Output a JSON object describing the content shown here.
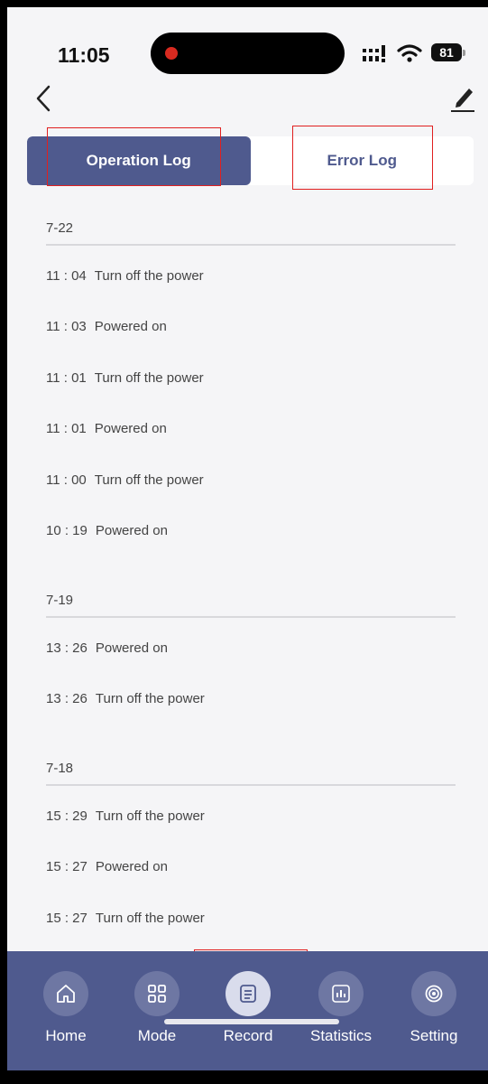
{
  "status_bar": {
    "time": "11:05",
    "battery": "81"
  },
  "tabs": {
    "operation": "Operation Log",
    "error": "Error Log",
    "active": "operation"
  },
  "groups": [
    {
      "date": "7-22",
      "entries": [
        {
          "time": "11 : 04",
          "text": "Turn off the power"
        },
        {
          "time": "11 : 03",
          "text": "Powered on"
        },
        {
          "time": "11 : 01",
          "text": "Turn off the power"
        },
        {
          "time": "11 : 01",
          "text": "Powered on"
        },
        {
          "time": "11 : 00",
          "text": "Turn off the power"
        },
        {
          "time": "10 : 19",
          "text": "Powered on"
        }
      ]
    },
    {
      "date": "7-19",
      "entries": [
        {
          "time": "13 : 26",
          "text": "Powered on"
        },
        {
          "time": "13 : 26",
          "text": "Turn off the power"
        }
      ]
    },
    {
      "date": "7-18",
      "entries": [
        {
          "time": "15 : 29",
          "text": "Turn off the power"
        },
        {
          "time": "15 : 27",
          "text": "Powered on"
        },
        {
          "time": "15 : 27",
          "text": "Turn off the power"
        }
      ]
    }
  ],
  "nav": {
    "home": "Home",
    "mode": "Mode",
    "record": "Record",
    "statistics": "Statistics",
    "setting": "Setting",
    "active": "record"
  },
  "colors": {
    "accent": "#4f5a8e",
    "highlight_box": "#e02020",
    "background": "#f5f5f7"
  }
}
